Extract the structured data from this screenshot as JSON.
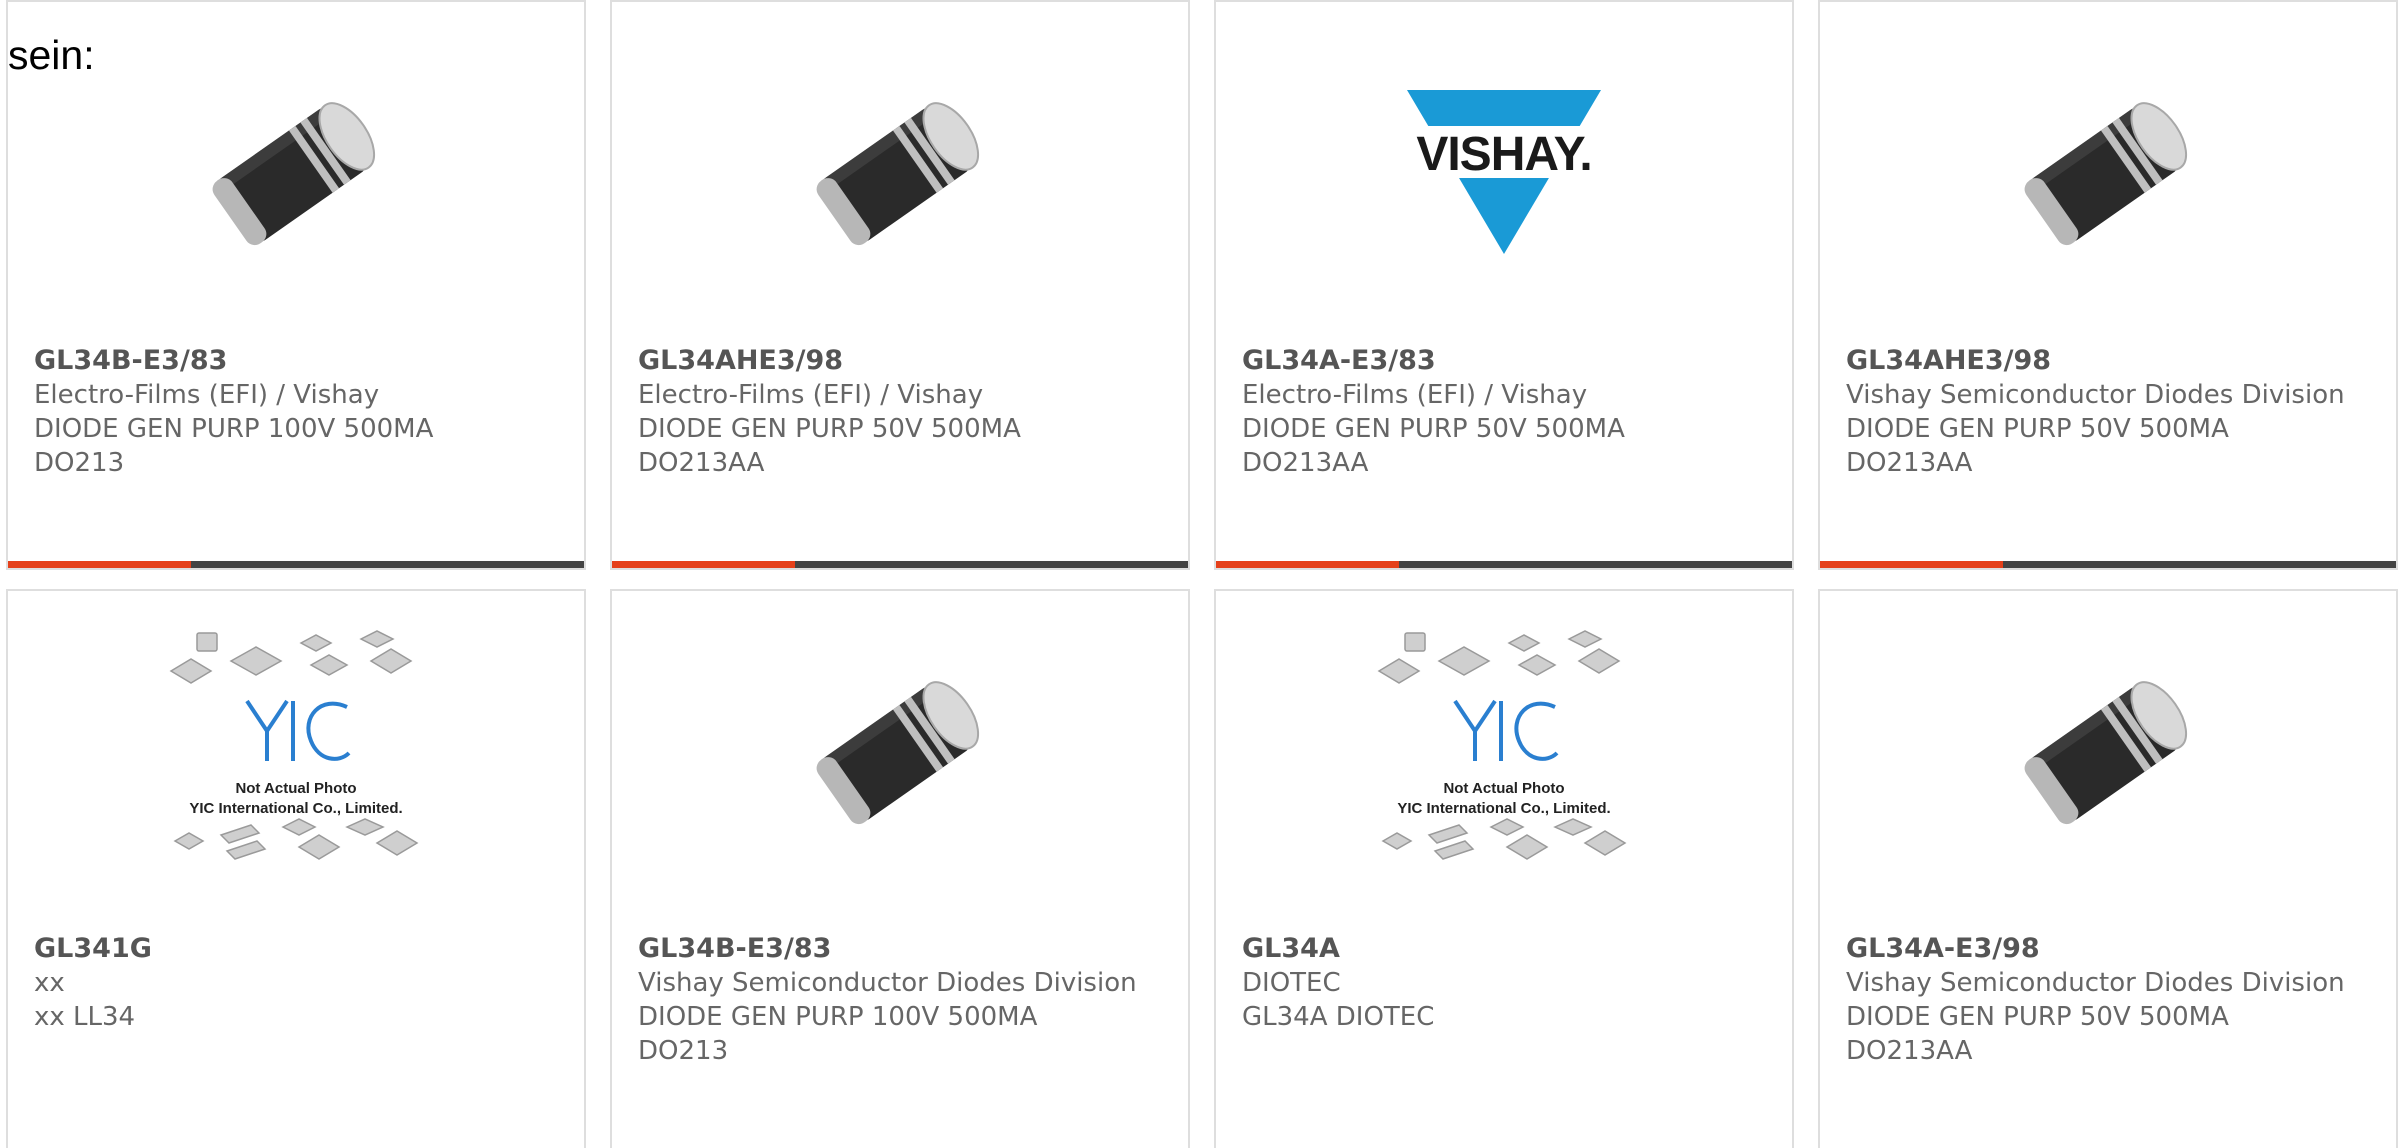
{
  "intro_text": "sein:",
  "colors": {
    "accent": "#e5401a",
    "bar": "#444444",
    "border": "#dedede",
    "vishay_blue": "#1a9ad6",
    "yic_blue": "#2a7fd0"
  },
  "cards": [
    {
      "part": "GL34B-E3/83",
      "maker": "Electro-Films (EFI) / Vishay",
      "desc": "DIODE GEN PURP 100V 500MA",
      "desc2": "DO213",
      "image": "diode-photo"
    },
    {
      "part": "GL34AHE3/98",
      "maker": "Electro-Films (EFI) / Vishay",
      "desc": "DIODE GEN PURP 50V 500MA",
      "desc2": "DO213AA",
      "image": "diode-photo"
    },
    {
      "part": "GL34A-E3/83",
      "maker": "Electro-Films (EFI) / Vishay",
      "desc": "DIODE GEN PURP 50V 500MA",
      "desc2": "DO213AA",
      "image": "vishay-logo",
      "logo_text": "VISHAY."
    },
    {
      "part": "GL34AHE3/98",
      "maker": "Vishay Semiconductor Diodes Division",
      "desc": "DIODE GEN PURP 50V 500MA",
      "desc2": "DO213AA",
      "image": "diode-photo"
    },
    {
      "part": "GL341G",
      "maker": "xx",
      "desc": "xx LL34",
      "desc2": "",
      "image": "yic-placeholder",
      "placeholder_line1": "Not Actual Photo",
      "placeholder_line2": "YIC International Co., Limited."
    },
    {
      "part": "GL34B-E3/83",
      "maker": "Vishay Semiconductor Diodes Division",
      "desc": "DIODE GEN PURP 100V 500MA",
      "desc2": "DO213",
      "image": "diode-photo"
    },
    {
      "part": "GL34A",
      "maker": "DIOTEC",
      "desc": "GL34A DIOTEC",
      "desc2": "",
      "image": "yic-placeholder",
      "placeholder_line1": "Not Actual Photo",
      "placeholder_line2": "YIC International Co., Limited."
    },
    {
      "part": "GL34A-E3/98",
      "maker": "Vishay Semiconductor Diodes Division",
      "desc": "DIODE GEN PURP 50V 500MA",
      "desc2": "DO213AA",
      "image": "diode-photo"
    }
  ]
}
